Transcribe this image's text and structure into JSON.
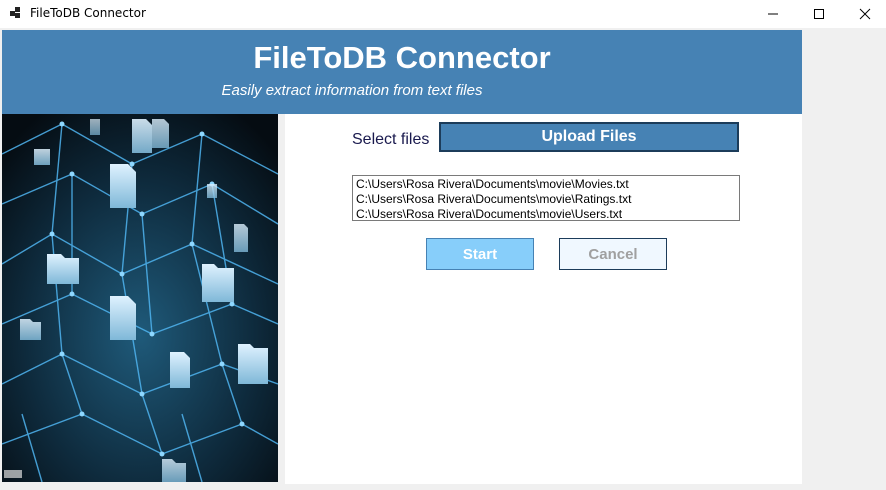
{
  "window": {
    "title": "FileToDB Connector",
    "minimize_icon": "minimize-icon",
    "maximize_icon": "maximize-icon",
    "close_icon": "close-icon"
  },
  "header": {
    "title": "FileToDB Connector",
    "subtitle": "Easily extract information from text files",
    "background_color": "#4682b4"
  },
  "upload": {
    "label": "Select files",
    "button_label": "Upload Files"
  },
  "files": [
    "C:\\Users\\Rosa Rivera\\Documents\\movie\\Movies.txt",
    "C:\\Users\\Rosa Rivera\\Documents\\movie\\Ratings.txt",
    "C:\\Users\\Rosa Rivera\\Documents\\movie\\Users.txt"
  ],
  "actions": {
    "start_label": "Start",
    "cancel_label": "Cancel"
  },
  "colors": {
    "start_button": "#87cefa",
    "cancel_button": "#f0f8ff"
  }
}
